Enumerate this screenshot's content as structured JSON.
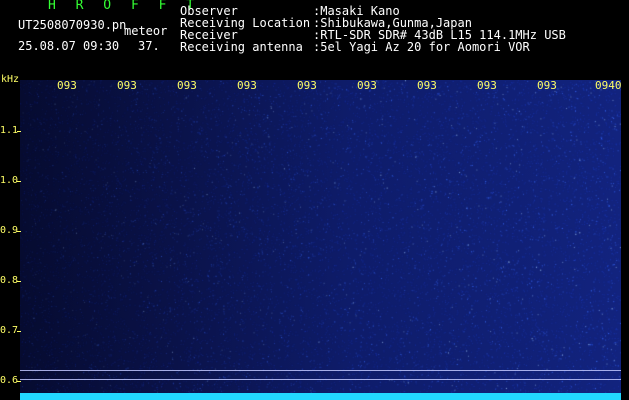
{
  "header": {
    "title": "H R O F F T",
    "filename": "UT2508070930.pn",
    "meteor_label": "meteor",
    "datetime": "25.08.07 09:30",
    "count": "37."
  },
  "info": [
    {
      "label": "Observer",
      "value": ":Masaki Kano"
    },
    {
      "label": "Receiving Location",
      "value": ":Shibukawa,Gunma,Japan"
    },
    {
      "label": "Receiver",
      "value": ":RTL-SDR SDR# 43dB L15 114.1MHz USB"
    },
    {
      "label": "Receiving antenna",
      "value": ":5el Yagi Az 20 for Aomori VOR"
    }
  ],
  "axes": {
    "y_unit": "kHz",
    "y_ticks": [
      "1.1",
      "1.0",
      "0.9",
      "0.8",
      "0.7",
      "0.6"
    ],
    "x_ticks": [
      "093",
      "093",
      "093",
      "093",
      "093",
      "093",
      "093",
      "093",
      "093",
      "0940"
    ]
  },
  "colors": {
    "label": "#33ff33",
    "axis": "#ffff66",
    "signal": "#22d8ff"
  }
}
